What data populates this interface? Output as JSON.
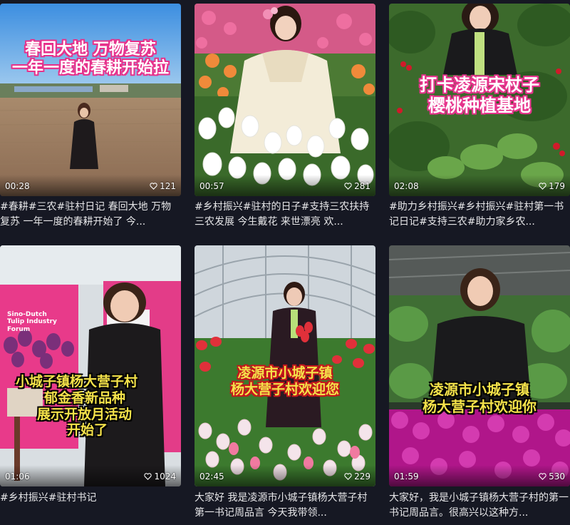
{
  "videos": [
    {
      "overlay_lines": [
        "春回大地 万物复苏",
        "一年一度的春耕开始拉"
      ],
      "duration": "00:28",
      "likes": "121",
      "caption": "#春耕#三农#驻村日记 春回大地 万物复苏 一年一度的春耕开始了 今..."
    },
    {
      "overlay_lines": [],
      "duration": "00:57",
      "likes": "281",
      "caption": "#乡村振兴#驻村的日子#支持三农扶持三农发展 今生戴花 来世漂亮 欢..."
    },
    {
      "overlay_lines": [
        "打卡凌源宋杖子",
        "樱桃种植基地"
      ],
      "duration": "02:08",
      "likes": "179",
      "caption": "#助力乡村振兴#乡村振兴#驻村第一书记日记#支持三农#助力家乡农..."
    },
    {
      "overlay_lines": [
        "小城子镇杨大营子村",
        "郁金香新品种",
        "展示开放月活动",
        "开始了"
      ],
      "banner_lines": [
        "Sino-Dutch",
        "Tulip Industry",
        "Forum"
      ],
      "duration": "01:06",
      "likes": "1024",
      "caption": "#乡村振兴#驻村书记"
    },
    {
      "overlay_lines": [
        "凌源市小城子镇",
        "杨大营子村欢迎您"
      ],
      "duration": "02:45",
      "likes": "229",
      "caption": "大家好 我是凌源市小城子镇杨大营子村第一书记周品言 今天我带领..."
    },
    {
      "overlay_lines": [
        "凌源市小城子镇",
        "杨大营子村欢迎你"
      ],
      "duration": "01:59",
      "likes": "530",
      "caption": "大家好，我是小城子镇杨大营子村的第一书记周品言。很高兴以这种方..."
    }
  ],
  "icons": {
    "like": "heart-outline-icon"
  },
  "colors": {
    "background": "#161823",
    "caption": "#e6e6e8"
  }
}
